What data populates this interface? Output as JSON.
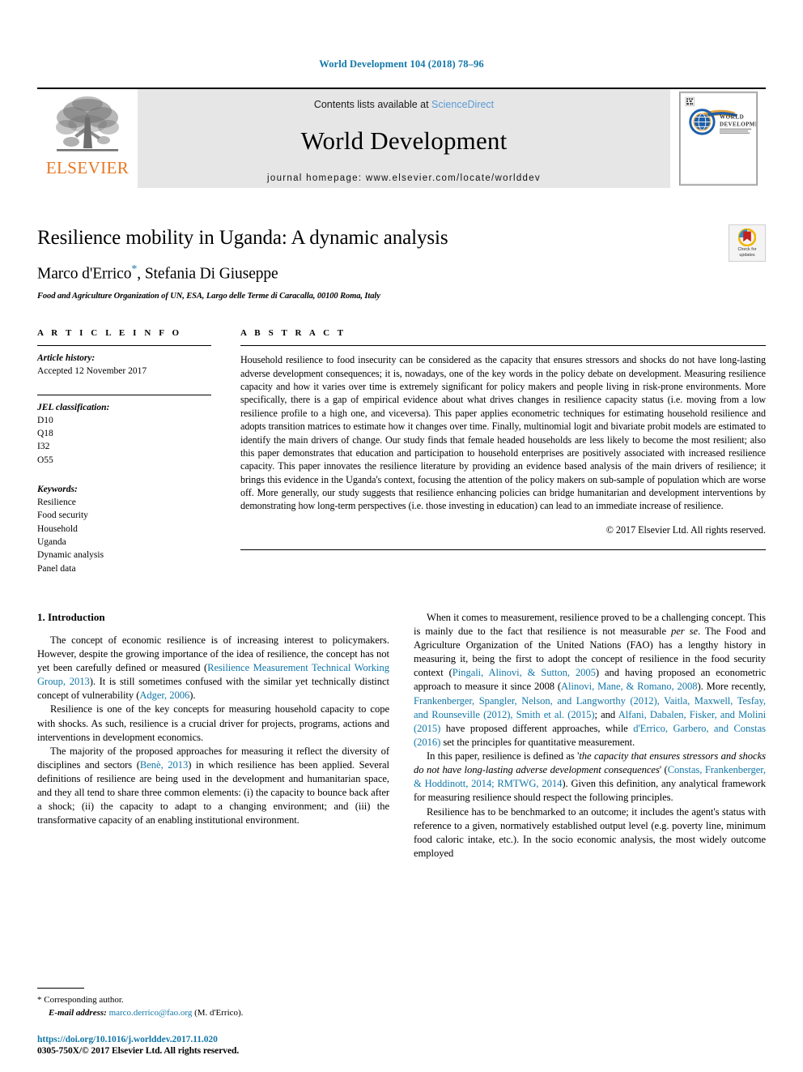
{
  "running_head": "World Development 104 (2018) 78–96",
  "masthead": {
    "contents_prefix": "Contents lists available at ",
    "sciencedirect": "ScienceDirect",
    "journal_name": "World Development",
    "homepage": "journal homepage: www.elsevier.com/locate/worlddev",
    "publisher_word": "ELSEVIER",
    "publisher_color": "#e87722",
    "link_color": "#5b9bd5",
    "cover": {
      "line1": "WORLD",
      "line2": "DEVELOPMENT"
    }
  },
  "article": {
    "title": "Resilience mobility in Uganda: A dynamic analysis",
    "authors": "Marco d'Errico",
    "authors_rest": ", Stefania Di Giuseppe",
    "corresponding_marker": "*",
    "affiliation": "Food and Agriculture Organization of UN, ESA, Largo delle Terme di Caracalla, 00100 Roma, Italy",
    "crossmark": {
      "line1": "Check for",
      "line2": "updates"
    }
  },
  "info": {
    "heading": "A R T I C L E   I N F O",
    "history_label": "Article history:",
    "history_value": "Accepted 12 November 2017",
    "jel_label": "JEL classification:",
    "jel_codes": [
      "D10",
      "Q18",
      "I32",
      "O55"
    ],
    "keywords_label": "Keywords:",
    "keywords": [
      "Resilience",
      "Food security",
      "Household",
      "Uganda",
      "Dynamic analysis",
      "Panel data"
    ]
  },
  "abstract": {
    "heading": "A B S T R A C T",
    "text": "Household resilience to food insecurity can be considered as the capacity that ensures stressors and shocks do not have long-lasting adverse development consequences; it is, nowadays, one of the key words in the policy debate on development. Measuring resilience capacity and how it varies over time is extremely significant for policy makers and people living in risk-prone environments. More specifically, there is a gap of empirical evidence about what drives changes in resilience capacity status (i.e. moving from a low resilience profile to a high one, and viceversa). This paper applies econometric techniques for estimating household resilience and adopts transition matrices to estimate how it changes over time. Finally, multinomial logit and bivariate probit models are estimated to identify the main drivers of change. Our study finds that female headed households are less likely to become the most resilient; also this paper demonstrates that education and participation to household enterprises are positively associated with increased resilience capacity. This paper innovates the resilience literature by providing an evidence based analysis of the main drivers of resilience; it brings this evidence in the Uganda's context, focusing the attention of the policy makers on sub-sample of population which are worse off. More generally, our study suggests that resilience enhancing policies can bridge humanitarian and development interventions by demonstrating how long-term perspectives (i.e. those investing in education) can lead to an immediate increase of resilience.",
    "copyright": "© 2017 Elsevier Ltd. All rights reserved."
  },
  "body": {
    "section_title": "1. Introduction",
    "left_paragraphs": [
      {
        "parts": [
          {
            "t": "The concept of economic resilience is of increasing interest to policymakers. However, despite the growing importance of the idea of resilience, the concept has not yet been carefully defined or measured ("
          },
          {
            "t": "Resilience Measurement Technical Working Group, 2013",
            "s": "cite"
          },
          {
            "t": "). It is still sometimes confused with the similar yet technically distinct concept of vulnerability ("
          },
          {
            "t": "Adger, 2006",
            "s": "cite"
          },
          {
            "t": ")."
          }
        ]
      },
      {
        "parts": [
          {
            "t": "Resilience is one of the key concepts for measuring household capacity to cope with shocks. As such, resilience is a crucial driver for projects, programs, actions and interventions in development economics."
          }
        ]
      },
      {
        "parts": [
          {
            "t": "The majority of the proposed approaches for measuring it reflect the diversity of disciplines and sectors ("
          },
          {
            "t": "Benè, 2013",
            "s": "cite"
          },
          {
            "t": ") in which resilience has been applied. Several definitions of resilience are being used in the development and humanitarian space, and they all tend to share three common elements: (i) the capacity to bounce back after a shock; (ii) the capacity to adapt to a changing environment; and (iii) the transformative capacity of an enabling institutional environment."
          }
        ]
      }
    ],
    "right_paragraphs": [
      {
        "parts": [
          {
            "t": "When it comes to measurement, resilience proved to be a challenging concept. This is mainly due to the fact that resilience is not measurable "
          },
          {
            "t": "per se",
            "s": "ital"
          },
          {
            "t": ". The Food and Agriculture Organization of the United Nations (FAO) has a lengthy history in measuring it, being the first to adopt the concept of resilience in the food security context ("
          },
          {
            "t": "Pingali, Alinovi, & Sutton, 2005",
            "s": "cite"
          },
          {
            "t": ") and having proposed an econometric approach to measure it since 2008 ("
          },
          {
            "t": "Alinovi, Mane, & Romano, 2008",
            "s": "cite"
          },
          {
            "t": "). More recently, "
          },
          {
            "t": "Frankenberger, Spangler, Nelson, and Langworthy (2012), Vaitla, Maxwell, Tesfay, and Rounseville (2012), Smith et al. (2015)",
            "s": "cite"
          },
          {
            "t": "; and "
          },
          {
            "t": "Alfani, Dabalen, Fisker, and Molini (2015)",
            "s": "cite"
          },
          {
            "t": " have proposed different approaches, while "
          },
          {
            "t": "d'Errico, Garbero, and Constas (2016)",
            "s": "cite"
          },
          {
            "t": " set the principles for quantitative measurement."
          }
        ]
      },
      {
        "parts": [
          {
            "t": "In this paper, resilience is defined as '"
          },
          {
            "t": "the capacity that ensures stressors and shocks do not have long-lasting adverse development consequences",
            "s": "ital"
          },
          {
            "t": "' ("
          },
          {
            "t": "Constas, Frankenberger, & Hoddinott, 2014; RMTWG, 2014",
            "s": "cite"
          },
          {
            "t": "). Given this definition, any analytical framework for measuring resilience should respect the following principles."
          }
        ]
      },
      {
        "parts": [
          {
            "t": "Resilience has to be benchmarked to an outcome; it includes the agent's status with reference to a given, normatively established output level (e.g. poverty line, minimum food caloric intake, etc.). In the socio economic analysis, the most widely outcome employed"
          }
        ]
      }
    ]
  },
  "footnote": {
    "star": "*",
    "corresponding": "Corresponding author.",
    "email_label": "E-mail address:",
    "email": "marco.derrico@fao.org",
    "email_suffix": "(M. d'Errico)."
  },
  "footer": {
    "doi": "https://doi.org/10.1016/j.worlddev.2017.11.020",
    "issn": "0305-750X/© 2017 Elsevier Ltd. All rights reserved."
  }
}
